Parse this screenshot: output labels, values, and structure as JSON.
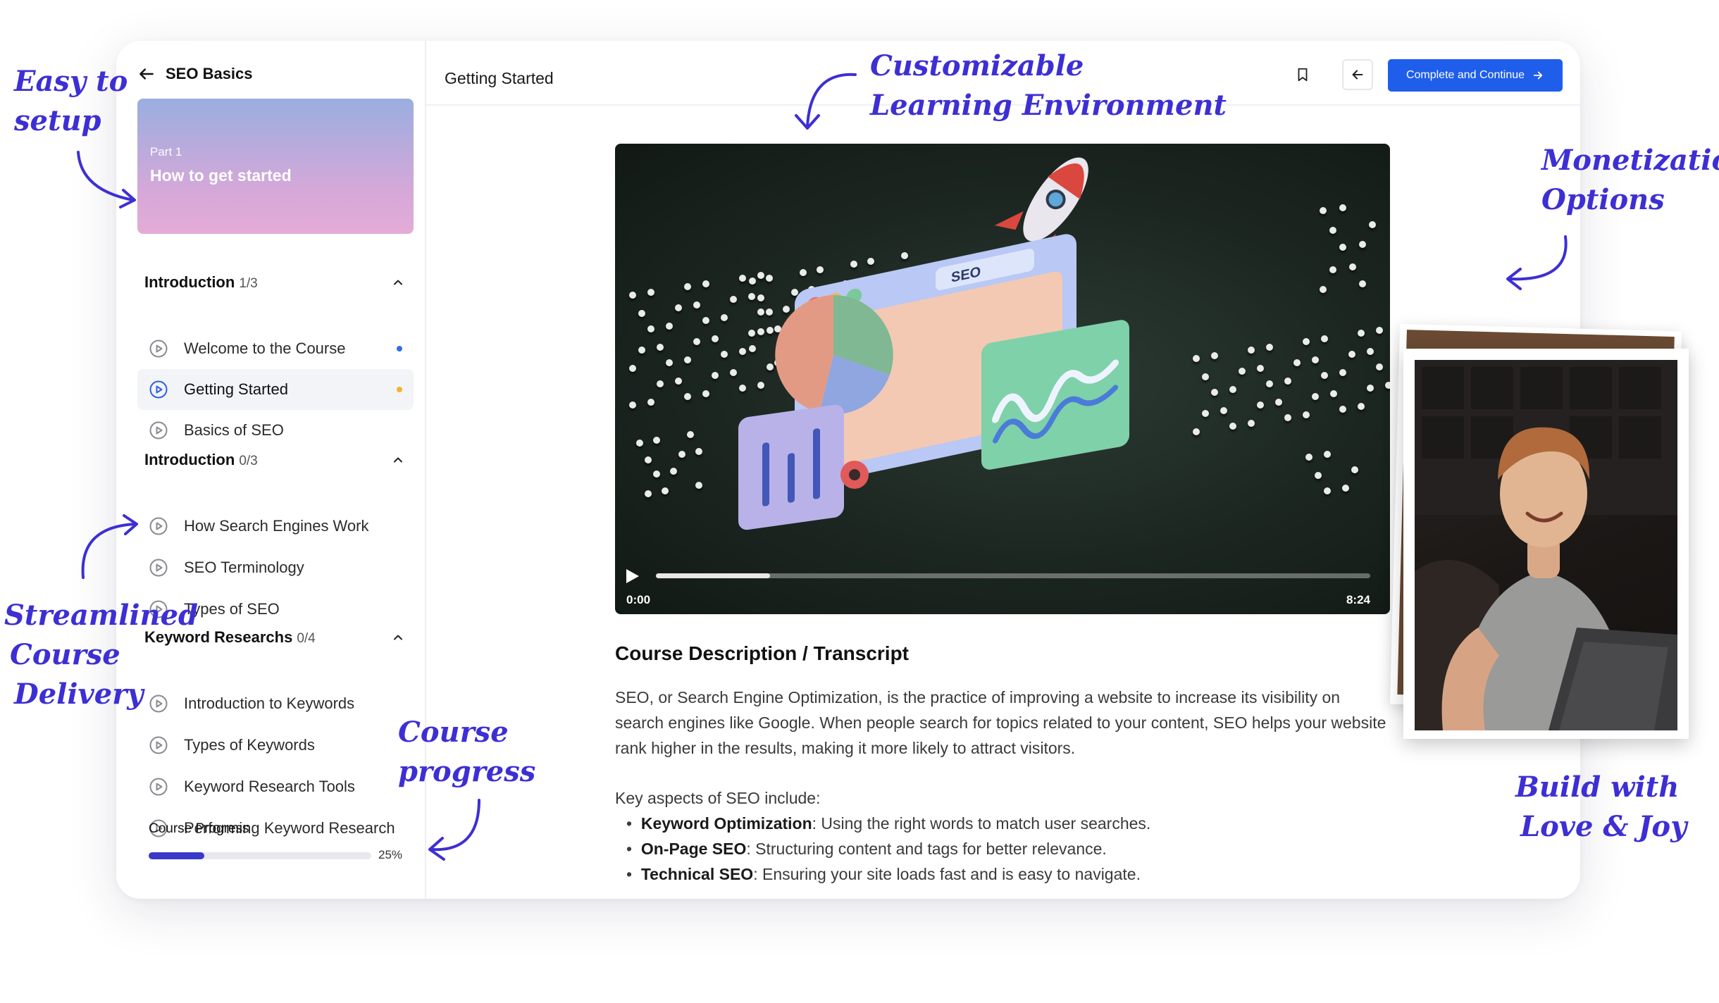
{
  "sidebar": {
    "course_name": "SEO Basics",
    "part_card": {
      "part_label": "Part 1",
      "title": "How to get started"
    },
    "sections": [
      {
        "title": "Introduction",
        "count": "1/3",
        "lessons": [
          {
            "label": "Welcome to the Course",
            "status_color": "#2f6df0"
          },
          {
            "label": "Getting Started",
            "status_color": "#f2b233",
            "active": true
          },
          {
            "label": "Basics of SEO"
          }
        ]
      },
      {
        "title": "Introduction",
        "count": "0/3",
        "lessons": [
          {
            "label": "How Search Engines Work"
          },
          {
            "label": "SEO Terminology"
          },
          {
            "label": "Types of SEO"
          }
        ]
      },
      {
        "title": "Keyword Researchs",
        "count": "0/4",
        "lessons": [
          {
            "label": "Introduction to Keywords"
          },
          {
            "label": "Types of Keywords"
          },
          {
            "label": "Keyword Research Tools"
          },
          {
            "label": "Performing Keyword Research"
          }
        ]
      }
    ],
    "progress": {
      "label": "Course Progress",
      "percent_text": "25%",
      "value": 0.25
    }
  },
  "header": {
    "title": "Getting Started",
    "cta_label": "Complete and Continue"
  },
  "video": {
    "current_time": "0:00",
    "total_time": "8:24",
    "played_fraction": 0.16,
    "sign_text": "SEO"
  },
  "content": {
    "heading": "Course Description / Transcript",
    "paragraph": "SEO, or Search Engine Optimization, is the practice of improving a website to increase its visibility on search engines like Google. When people search for topics related to your content, SEO helps your website rank higher in the results, making it more likely to attract visitors.",
    "aspects_intro": "Key aspects of SEO include:",
    "aspects": [
      {
        "term": "Keyword Optimization",
        "text": ": Using the right words to match user searches."
      },
      {
        "term": "On-Page SEO",
        "text": ": Structuring content and tags for better relevance."
      },
      {
        "term": "Technical SEO",
        "text": ": Ensuring your site loads fast and is easy to navigate."
      }
    ]
  },
  "annotations": {
    "easy_setup": [
      "Easy to",
      "setup"
    ],
    "customizable": [
      "Customizable",
      "Learning Environment"
    ],
    "monetization": [
      "Monetization",
      "Options"
    ],
    "streamlined": [
      "Streamlined",
      "Course",
      "Delivery"
    ],
    "course_progress": [
      "Course",
      "progress"
    ],
    "build_with": [
      "Build with",
      "Love & Joy"
    ]
  },
  "colors": {
    "accent": "#1f5eea",
    "annotation": "#3d2fd4",
    "progress": "#3a38c8"
  }
}
